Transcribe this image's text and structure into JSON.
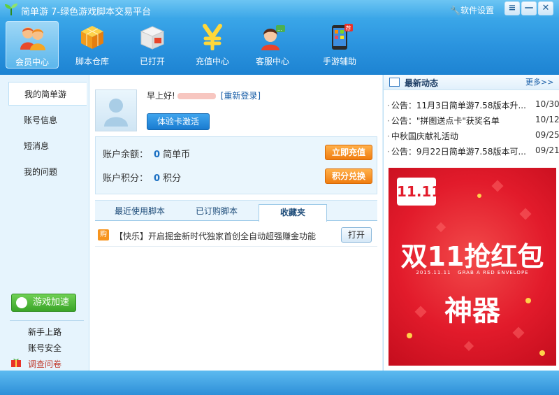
{
  "window": {
    "title": "简单游 7-绿色游戏脚本交易平台",
    "settings_label": "软件设置",
    "controls": [
      "≡",
      "—",
      "✕"
    ]
  },
  "nav": [
    {
      "label": "会员中心",
      "icon": "member-icon"
    },
    {
      "label": "脚本仓库",
      "icon": "cube-icon"
    },
    {
      "label": "已打开",
      "icon": "box-icon"
    },
    {
      "label": "充值中心",
      "icon": "yen-icon"
    },
    {
      "label": "客服中心",
      "icon": "support-icon"
    },
    {
      "label": "手游辅助",
      "icon": "phone-icon",
      "badge": "荐"
    }
  ],
  "sidebar": {
    "items": [
      "我的简单游",
      "账号信息",
      "短消息",
      "我的问题"
    ],
    "accel_button": "游戏加速",
    "links": [
      "新手上路",
      "账号安全",
      "调查问卷"
    ]
  },
  "profile": {
    "greeting": "早上好!",
    "relogin": "[重新登录]",
    "activate_button": "体验卡激活"
  },
  "account": {
    "balance_label": "账户余额：",
    "balance_value": "0",
    "balance_unit": "简单币",
    "recharge_button": "立即充值",
    "points_label": "账户积分：",
    "points_value": "0",
    "points_unit": "积分",
    "exchange_button": "积分兑换"
  },
  "tabs": [
    "最近使用脚本",
    "已订购脚本",
    "收藏夹"
  ],
  "favorites": [
    {
      "icon_text": "购",
      "text": "【快乐】开启掘金新时代独家首创全自动超强赚金功能",
      "button": "打开"
    }
  ],
  "news": {
    "title": "最新动态",
    "more": "更多>>",
    "items": [
      {
        "text": "公告：11月3日简单游7.58版本升...",
        "date": "10/30"
      },
      {
        "text": "公告：\"拼图送点卡\"获奖名单",
        "date": "10/12"
      },
      {
        "text": "中秋国庆献礼活动",
        "date": "09/25"
      },
      {
        "text": "公告：9月22日简单游7.58版本可...",
        "date": "09/21"
      }
    ]
  },
  "banner": {
    "badge": "11.11",
    "headline": "双11抢红包",
    "date_text": "2015.11.11",
    "subtitle": "GRAB A RED ENVELOPE",
    "footer": "神器"
  },
  "colors": {
    "accent": "#2b94df",
    "orange": "#f07d10",
    "banner_red": "#e21b2b",
    "green": "#3aa528"
  }
}
